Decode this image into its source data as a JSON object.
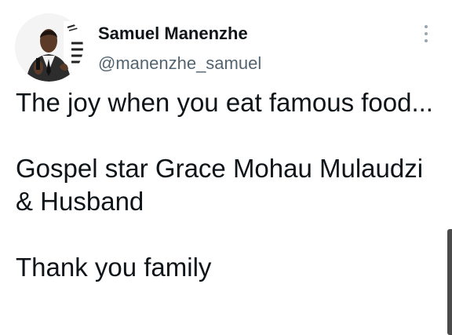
{
  "tweet": {
    "author": {
      "name": "Samuel Manenzhe",
      "handle": "@manenzhe_samuel"
    },
    "text": {
      "line_1": "The joy when you eat famous food...",
      "line_2": "Gospel star Grace Mohau Mulaudzi & Husband",
      "line_3": "Thank you family"
    }
  },
  "icons": {
    "menu": "more-vertical-icon",
    "profile": "avatar-icon"
  },
  "colors": {
    "text_primary": "#0f1419",
    "text_secondary": "#536471",
    "menu_dots": "#99a6b0",
    "scrollbar": "#4b4b4b"
  }
}
